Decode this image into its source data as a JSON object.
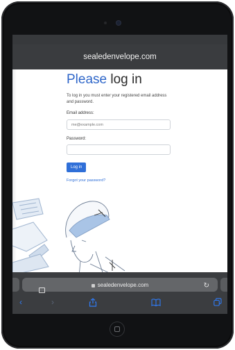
{
  "browser": {
    "header_url": "sealedenvelope.com",
    "address_url": "sealedenvelope.com"
  },
  "page": {
    "title_accent": "Please",
    "title_rest": " log in",
    "intro": "To log in you must enter your registered email address and password.",
    "email_label": "Email address:",
    "email_placeholder": "me@example.com",
    "password_label": "Password:",
    "login_button": "Log in",
    "forgot_link": "Forgot your password?"
  },
  "colors": {
    "accent": "#2e66c9",
    "button": "#2f6fd8",
    "toolbar_icon": "#2f7bf5",
    "browser_chrome": "#3b3d40"
  },
  "icons": [
    "tabs-icon",
    "lock-icon",
    "reload-icon",
    "back-icon",
    "forward-icon",
    "share-icon",
    "bookmarks-icon",
    "tab-overview-icon",
    "home-button"
  ]
}
